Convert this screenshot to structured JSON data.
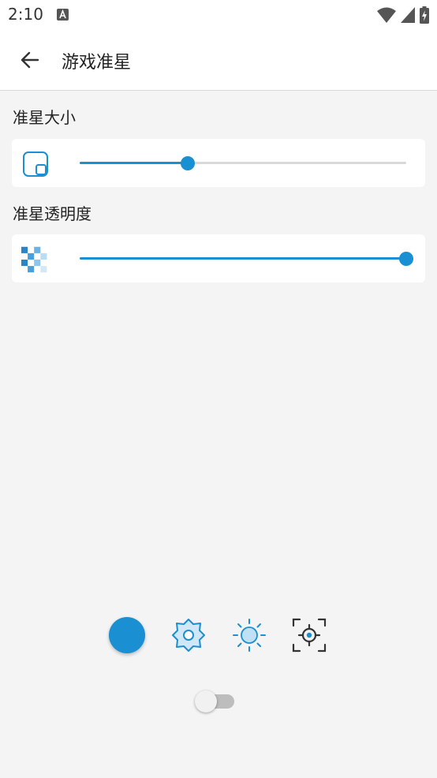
{
  "status_bar": {
    "time": "2:10"
  },
  "app_bar": {
    "title": "游戏准星"
  },
  "sections": [
    {
      "label": "准星大小",
      "icon": "resize-icon",
      "value_fraction": 0.33
    },
    {
      "label": "准星透明度",
      "icon": "checker-transparency-icon",
      "value_fraction": 1.0
    }
  ],
  "modes": [
    "filled-circle",
    "gear-flower-icon",
    "sun-icon",
    "crosshair-target-icon"
  ],
  "toggle": {
    "on": false
  },
  "colors": {
    "accent": "#1a8fd1",
    "background": "#f4f4f4",
    "track_off": "#d9d9d9"
  }
}
